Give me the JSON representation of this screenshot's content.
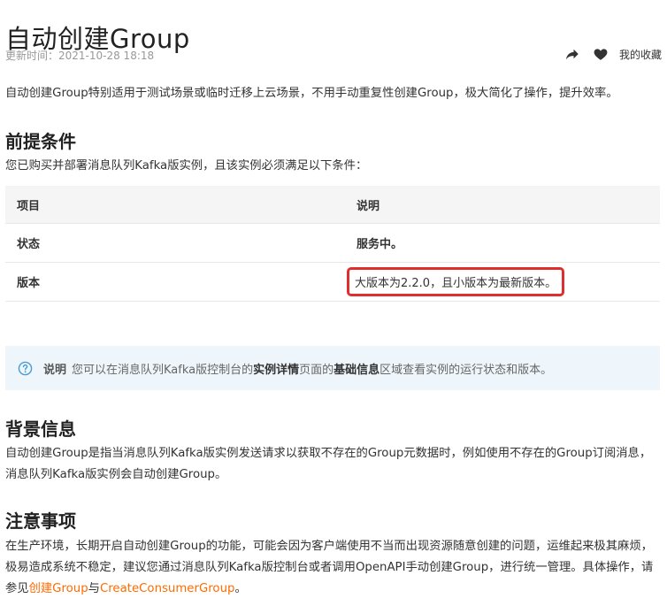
{
  "page": {
    "title": "自动创建Group",
    "updated_label": "更新时间：2021-10-28 18:18",
    "favorites_label": "我的收藏",
    "intro": "自动创建Group特别适用于测试场景或临时迁移上云场景，不用手动重复性创建Group，极大简化了操作，提升效率。"
  },
  "prereq": {
    "heading": "前提条件",
    "text": "您已购买并部署消息队列Kafka版实例，且该实例必须满足以下条件：",
    "table": {
      "headers": [
        "项目",
        "说明"
      ],
      "rows": [
        {
          "item": "状态",
          "desc": "服务中。"
        },
        {
          "item": "版本",
          "desc": "大版本为2.2.0，且小版本为最新版本。"
        }
      ]
    }
  },
  "note": {
    "label": "说明",
    "text_1": "您可以在消息队列Kafka版控制台的",
    "bold_1": "实例详情",
    "text_2": "页面的",
    "bold_2": "基础信息",
    "text_3": "区域查看实例的运行状态和版本。"
  },
  "background": {
    "heading": "背景信息",
    "text": "自动创建Group是指当消息队列Kafka版实例发送请求以获取不存在的Group元数据时，例如使用不存在的Group订阅消息，消息队列Kafka版实例会自动创建Group。"
  },
  "notes": {
    "heading": "注意事项",
    "text_1": "在生产环境，长期开启自动创建Group的功能，可能会因为客户端使用不当而出现资源随意创建的问题，运维起来极其麻烦，极易造成系统不稳定，建议您通过消息队列Kafka版控制台或者调用OpenAPI手动创建Group，进行统一管理。具体操作，请参见",
    "link_1": "创建Group",
    "text_2": "与",
    "link_2": "CreateConsumerGroup",
    "text_3": "。"
  },
  "colors": {
    "link": "#ff6a00",
    "highlight_border": "#e02d2d",
    "note_bg": "#eef6fb"
  },
  "icons": [
    "share-icon",
    "heart-icon",
    "question-circle-icon"
  ]
}
